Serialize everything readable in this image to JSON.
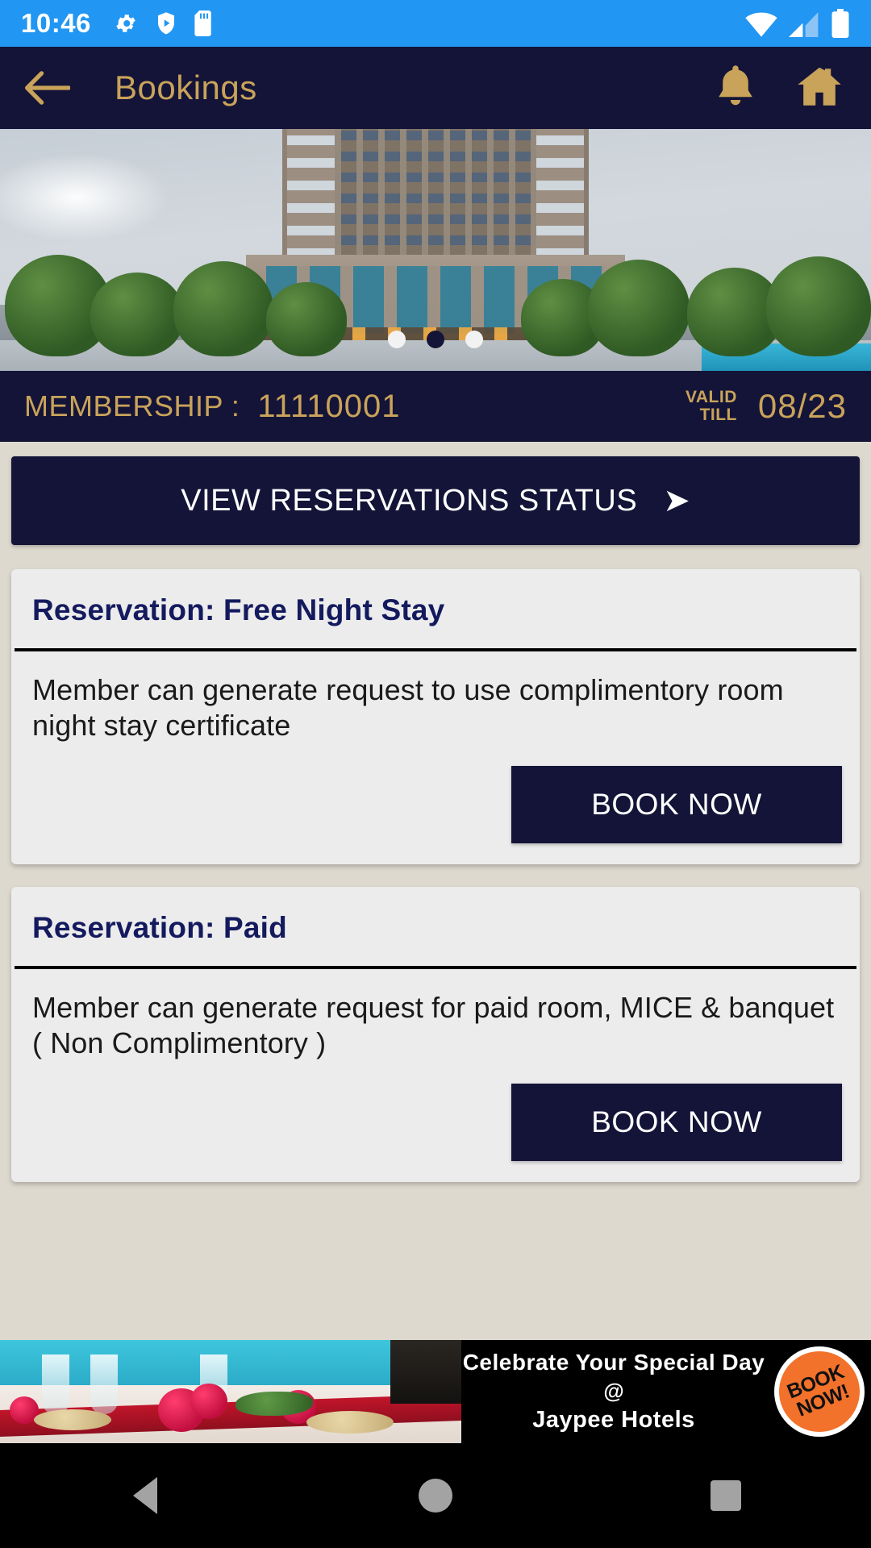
{
  "status_bar": {
    "time": "10:46",
    "left_icons": [
      "gear-icon",
      "shield-play-icon",
      "sd-card-icon"
    ],
    "right_icons": [
      "wifi-icon",
      "cellular-signal-icon",
      "battery-icon"
    ],
    "background_color": "#2196f3"
  },
  "app_bar": {
    "back_icon": "back-arrow-icon",
    "title": "Bookings",
    "notification_icon": "bell-icon",
    "home_icon": "home-icon",
    "background_color": "#141438",
    "accent_color": "#c9a35a"
  },
  "hero": {
    "image_description": "Jaypee hotel tower exterior at dusk with gardens",
    "carousel": {
      "total": 3,
      "active_index": 1
    }
  },
  "membership": {
    "label": "MEMBERSHIP :",
    "number": "11110001",
    "valid_till_line1": "VALID",
    "valid_till_line2": "TILL",
    "valid_till_date": "08/23"
  },
  "status_button": {
    "label": "VIEW RESERVATIONS STATUS",
    "arrow": "➤"
  },
  "cards": [
    {
      "title": "Reservation: Free Night Stay",
      "description": "Member can generate request to use complimentory room night stay certificate",
      "button_label": "BOOK NOW"
    },
    {
      "title": "Reservation: Paid",
      "description": "Member can generate request for paid room, MICE & banquet ( Non Complimentory )",
      "button_label": "BOOK NOW"
    }
  ],
  "ad": {
    "line1": "Celebrate Your Special Day",
    "line2": "@",
    "line3": "Jaypee Hotels",
    "badge_label": "BOOK NOW!",
    "badge_color": "#f2712b"
  },
  "nav_bar": {
    "back": "nav-back-icon",
    "home": "nav-home-icon",
    "recents": "nav-recents-icon"
  }
}
